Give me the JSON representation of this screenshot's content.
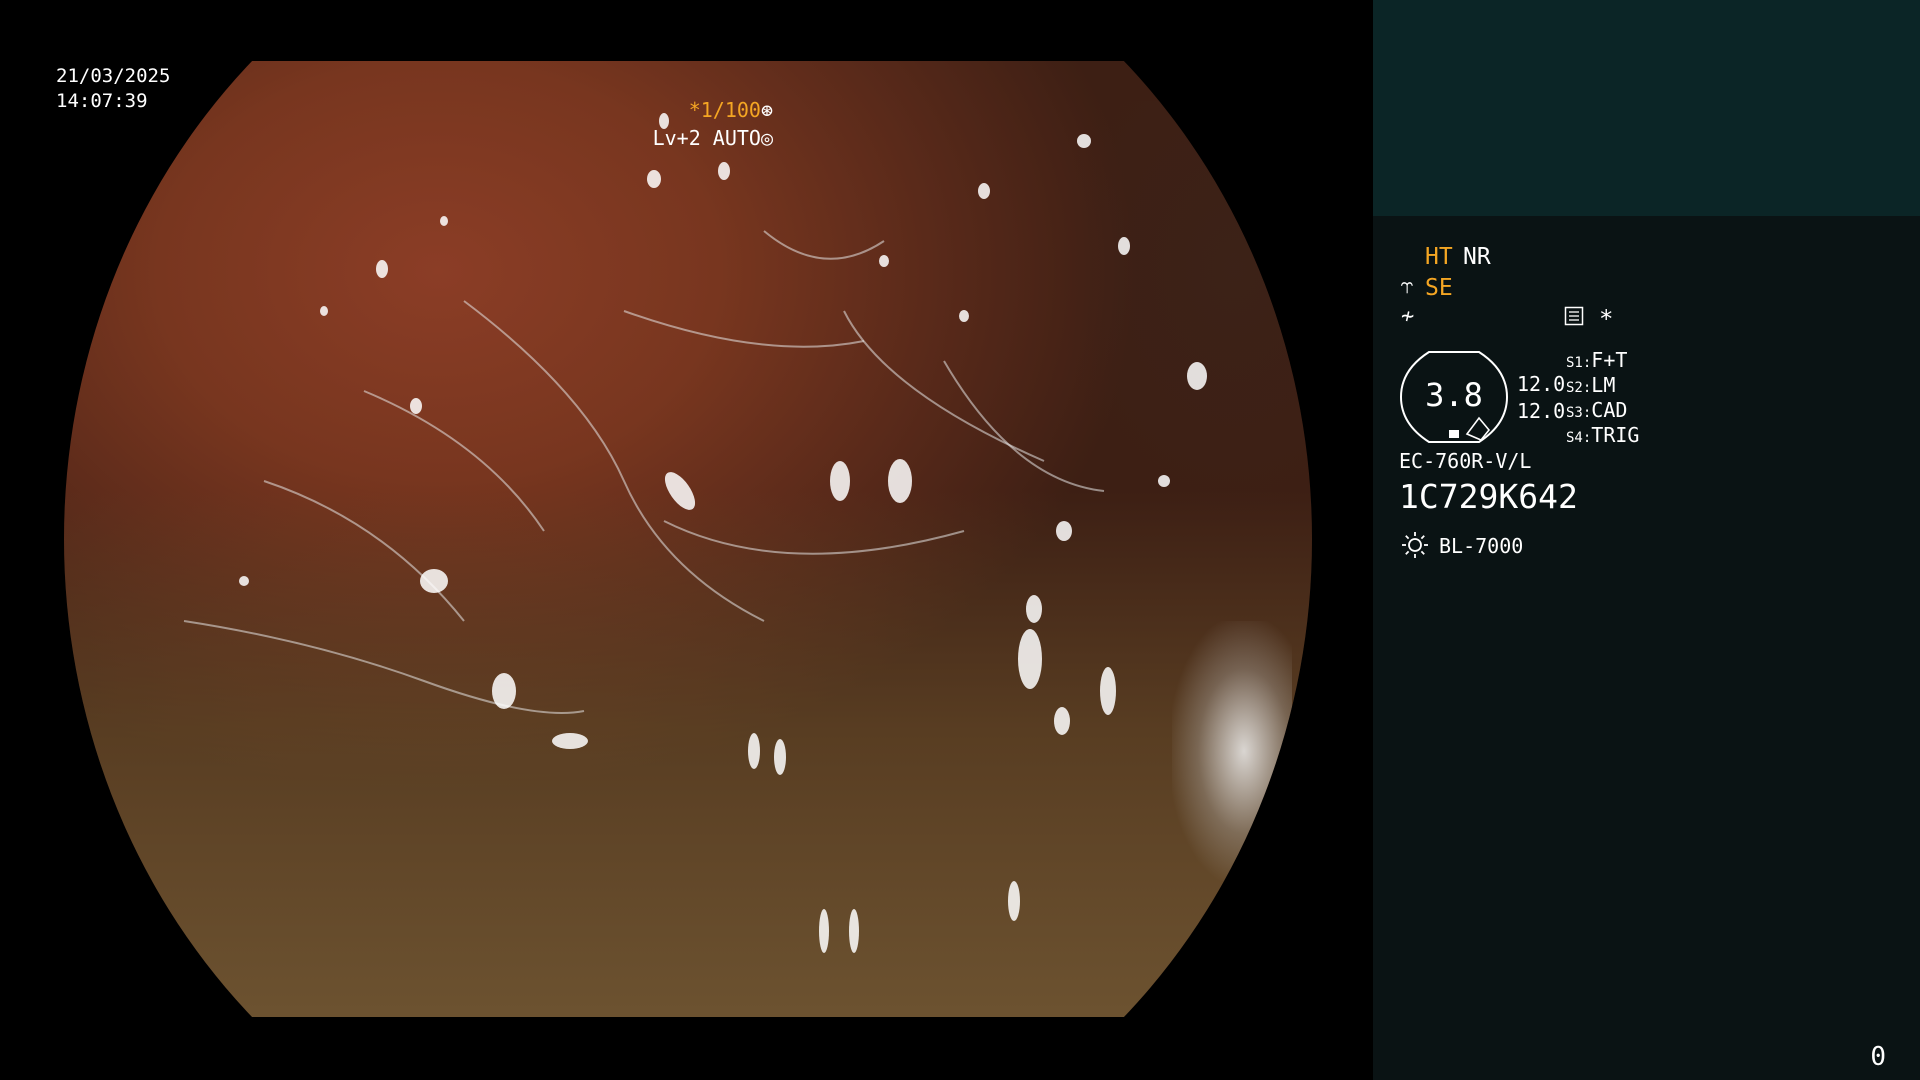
{
  "video": {
    "date": "21/03/2025",
    "time": "14:07:39",
    "shutter": "*1/100",
    "level": "Lv+2 AUTO"
  },
  "panel": {
    "header_color": "#0b2526",
    "modes": {
      "ht": "HT",
      "nr": "NR",
      "se": "SE",
      "star": "*"
    },
    "zoom": {
      "value": "3.8",
      "val_a": "12.0",
      "val_b": "12.0"
    },
    "switches": [
      {
        "key": "S1:",
        "label": "F+T"
      },
      {
        "key": "S2:",
        "label": "LM"
      },
      {
        "key": "S3:",
        "label": "CAD"
      },
      {
        "key": "S4:",
        "label": "TRIG"
      }
    ],
    "scope_model": "EC-760R-V/L",
    "serial": "1C729K642",
    "light_source": "BL-7000",
    "counter": "0"
  },
  "icons": {
    "shutter": "aperture-icon",
    "level": "auto-iris-icon",
    "se": "structure-enhance-icon",
    "flat": "color-mode-icon",
    "doc": "document-icon",
    "light": "light-source-icon"
  },
  "colors": {
    "accent": "#f5a623",
    "panel_bg": "#0a1314",
    "text": "#ffffff"
  }
}
